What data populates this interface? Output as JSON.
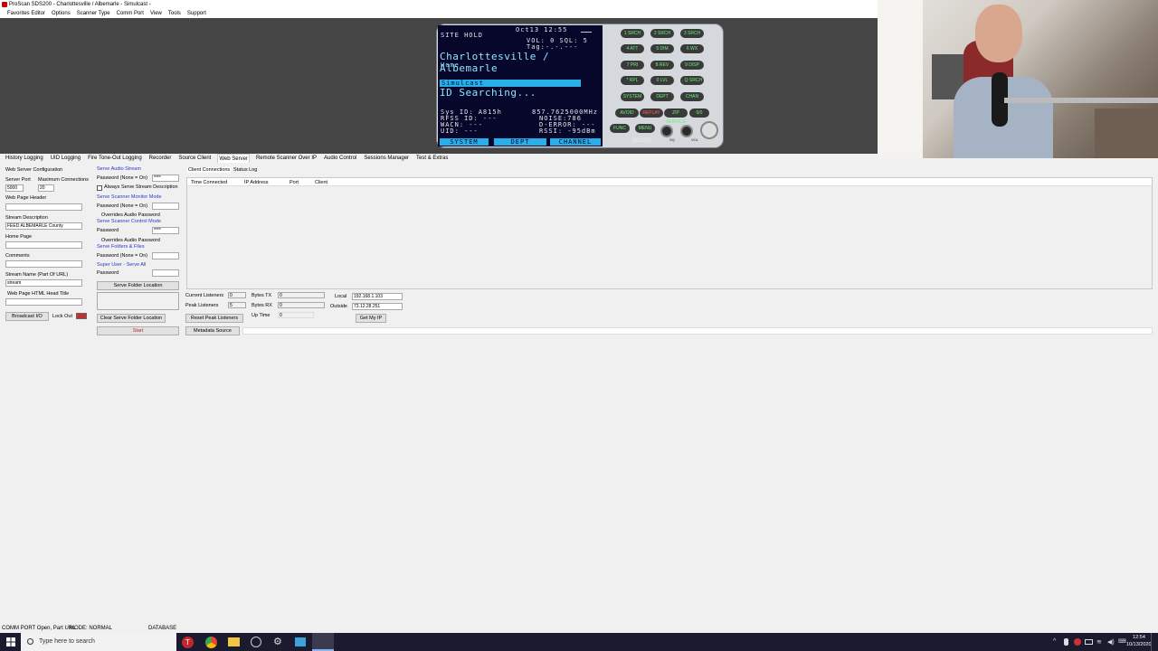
{
  "window": {
    "title": "ProScan SDS200 - Charlottesville / Albemarle - Simulcast -"
  },
  "menu": [
    "Favorites Editor",
    "Options",
    "Scanner Type",
    "Comm Port",
    "View",
    "Tools",
    "Support"
  ],
  "scanner": {
    "line1": "SITE HOLD",
    "datetime": "Oct13 12:55",
    "vol_sql": "VOL: 0 SQL: 5",
    "tag": "Tag:-.-.---",
    "system_name": "Charlottesville / Albemarle",
    "home": "Home",
    "simulcast": "Simulcast",
    "status": "ID Searching...",
    "sys_id": "Sys ID: A815h",
    "freq": "857.7625000MHz",
    "rfss_id": "RFSS ID: ---",
    "noise": "NOISE:786",
    "wacn": "WACN: ---",
    "d_error": "D-ERROR: ---",
    "uid": "UID: ---",
    "rssi": "RSSI: -95dBm",
    "bottom_system": "SYSTEM",
    "bottom_dept": "DEPT",
    "bottom_channel": "CHANNEL",
    "model": "SDS200",
    "keys": [
      "1 SRCH",
      "2 SRCH",
      "3 SRCH",
      "4 ATT",
      "5 DIM",
      "6 WX",
      "7 PRI",
      "8 REV",
      "9 DISP",
      "* RPL",
      "0 LVL",
      ". Q SRCH",
      "SYSTEM",
      "DEPT",
      "CHAN",
      "AVOID",
      "REPLAY",
      "ZIP SERVICE",
      "0/0",
      "FUNC",
      "MENU"
    ],
    "knob_labels": [
      "SQ",
      "VOL"
    ]
  },
  "tabs": [
    "History Logging",
    "UID Logging",
    "Fire Tone-Out Logging",
    "Recorder",
    "Source Client",
    "Web Server",
    "Remote Scanner Over IP",
    "Audio Control",
    "Sessions Manager",
    "Test & Extras"
  ],
  "active_tab": "Web Server",
  "config": {
    "section_title": "Web Server Configuration",
    "server_port_label": "Server Port",
    "server_port": "5000",
    "max_conn_label": "Maximum Connections",
    "max_conn": "20",
    "web_header_label": "Web Page Header",
    "web_header": "",
    "stream_desc_label": "Stream Description",
    "stream_desc": "FEED ALBEMARLE County",
    "home_page_label": "Home Page",
    "home_page": "",
    "comments_label": "Comments",
    "comments": "",
    "stream_name_label": "Stream Name (Part Of URL)",
    "stream_name": "stream",
    "html_title_label": "Web Page HTML Head Title",
    "html_title": "",
    "broadcast_btn": "Broadcast I/O",
    "lockout_label": "Lock Out"
  },
  "serve": {
    "audio_stream": "Serve Audio Stream",
    "pw_none_on": "Password (None = On)",
    "pw_audio": "****",
    "always_desc": "Always Serve Stream Description",
    "monitor_mode": "Serve Scanner Monitor Mode",
    "pw_monitor": "",
    "overrides1": "Overrides Audio Password",
    "control_mode": "Serve Scanner Control Mode",
    "password_label": "Password",
    "pw_control": "****",
    "overrides2": "Overrides Audio Password",
    "folders_files": "Serve Folders & Files",
    "pw_folders": "",
    "super_user": "Super User - Serve All",
    "pw_super": "",
    "serve_folder_btn": "Serve Folder Location",
    "folder_path": "",
    "clear_folder_btn": "Clear Serve Folder Location",
    "start_btn": "Start"
  },
  "inner_tabs": [
    "Client Connections",
    "Status Log"
  ],
  "columns": [
    "Time Connected",
    "IP Address",
    "Port",
    "Client"
  ],
  "stats": {
    "current_listeners_label": "Current Listeners",
    "current_listeners": "0",
    "peak_listeners_label": "Peak Listeners",
    "peak_listeners": "5",
    "bytes_tx_label": "Bytes TX",
    "bytes_tx": "0",
    "bytes_rx_label": "Bytes RX",
    "bytes_rx": "0",
    "uptime_label": "Up Time",
    "uptime": "0",
    "local_label": "Local",
    "local_ip": "192.168.1.103",
    "outside_label": "Outside",
    "outside_ip": "73.12.28.251",
    "get_ip_btn": "Get My IP",
    "reset_peak_btn": "Reset Peak Listeners",
    "metadata_btn": "Metadata Source"
  },
  "statusbar": {
    "comm": "COMM PORT Open, Part URL",
    "mode": "MODE: NORMAL",
    "db": "DATABASE"
  },
  "taskbar": {
    "search_placeholder": "Type here to search",
    "time": "12:54",
    "date": "10/13/2020"
  }
}
